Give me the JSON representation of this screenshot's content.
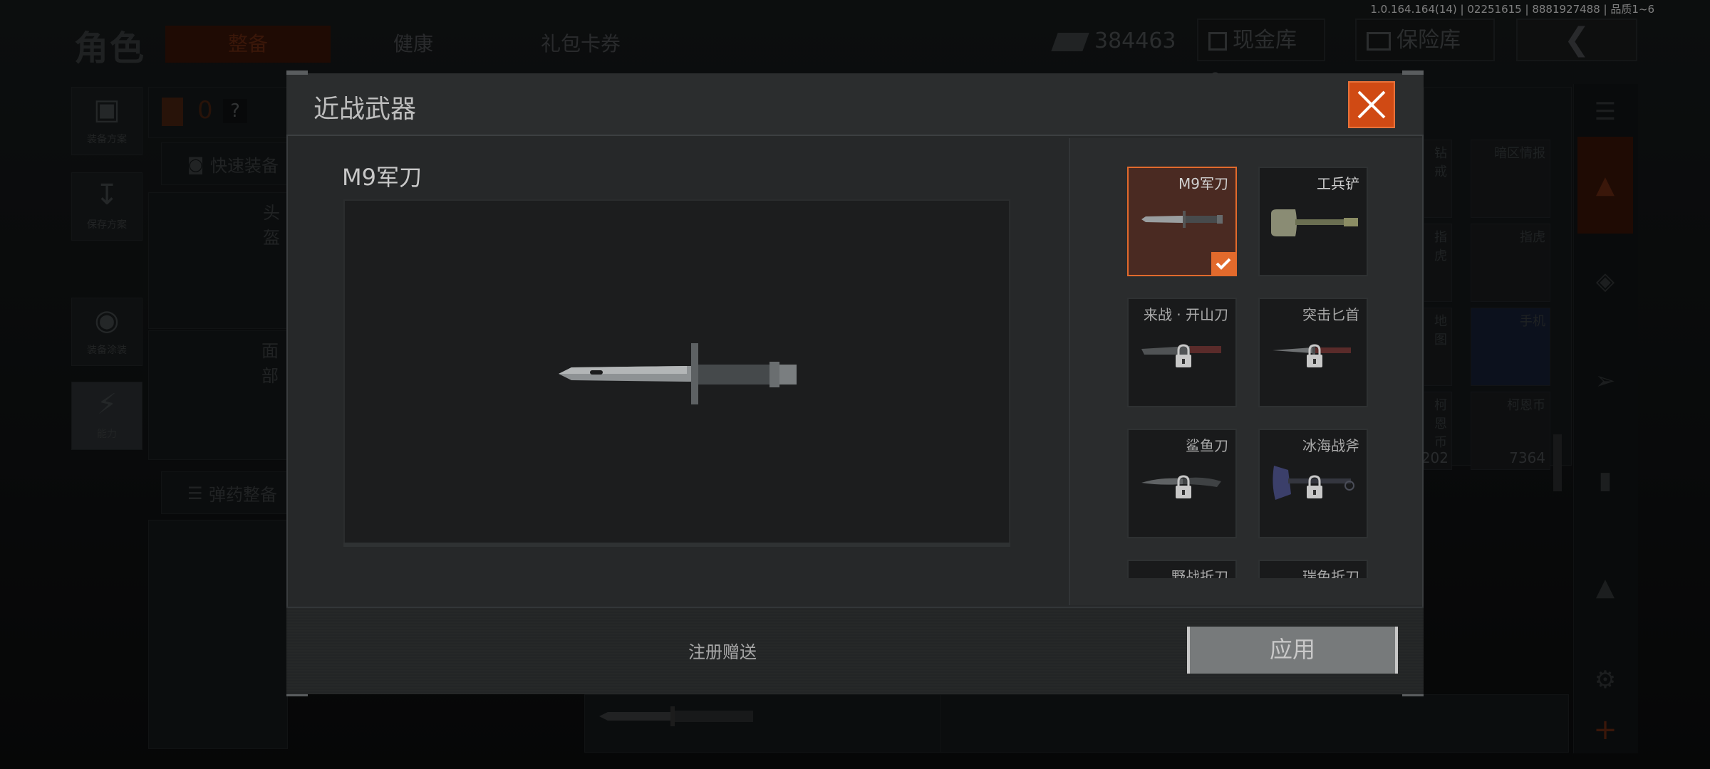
{
  "version_info": "1.0.164.164(14) | 02251615 | 8881927488 | 品质1~6",
  "background": {
    "page_title": "角色",
    "tabs": [
      {
        "label": "整备",
        "active": true
      },
      {
        "label": "健康",
        "active": false
      },
      {
        "label": "礼包卡券",
        "active": false
      }
    ],
    "currency_amount": "384463",
    "cash_vault_label": "现金库 0",
    "safe_box_label": "保险库",
    "left_menu": [
      {
        "label": "装备方案",
        "icon": "vest-icon"
      },
      {
        "label": "保存方案",
        "icon": "download-icon"
      },
      {
        "label": "装备涂装",
        "icon": "helmet-icon"
      },
      {
        "label": "能力",
        "icon": "lightning-icon"
      }
    ],
    "stat_count": "0",
    "stat_unknown": "?",
    "quick_equip_label": "快速装备",
    "slot_head": "头盔",
    "slot_face": "面部",
    "ammo_label": "弹药整备",
    "grid_items": [
      {
        "name": "钻戒",
        "count": ""
      },
      {
        "name": "暗区情报",
        "count": ""
      },
      {
        "name": "指虎",
        "count": ""
      },
      {
        "name": "指虎",
        "count": ""
      },
      {
        "name": "地图",
        "count": ""
      },
      {
        "name": "手机",
        "count": ""
      },
      {
        "name": "柯恩币",
        "count": "202"
      },
      {
        "name": "柯恩币",
        "count": "7364"
      }
    ]
  },
  "modal": {
    "title": "近战武器",
    "selected_weapon_name": "M9军刀",
    "source_text": "注册赠送",
    "apply_label": "应用",
    "weapons": [
      {
        "name": "M9军刀",
        "selected": true,
        "locked": false,
        "icon": "bayonet-icon"
      },
      {
        "name": "工兵铲",
        "selected": false,
        "locked": false,
        "icon": "shovel-icon"
      },
      {
        "name": "来战 · 开山刀",
        "selected": false,
        "locked": true,
        "icon": "machete-icon"
      },
      {
        "name": "突击匕首",
        "selected": false,
        "locked": true,
        "icon": "dagger-icon"
      },
      {
        "name": "鲨鱼刀",
        "selected": false,
        "locked": true,
        "icon": "knife-icon"
      },
      {
        "name": "冰海战斧",
        "selected": false,
        "locked": true,
        "icon": "axe-icon"
      },
      {
        "name": "野战折刀",
        "selected": false,
        "locked": true,
        "icon": "folding-knife-icon"
      },
      {
        "name": "瑞兔折刀",
        "selected": false,
        "locked": true,
        "icon": "folding-knife-icon"
      }
    ]
  },
  "colors": {
    "accent": "#e26a2c",
    "modal_bg": "#262829"
  }
}
